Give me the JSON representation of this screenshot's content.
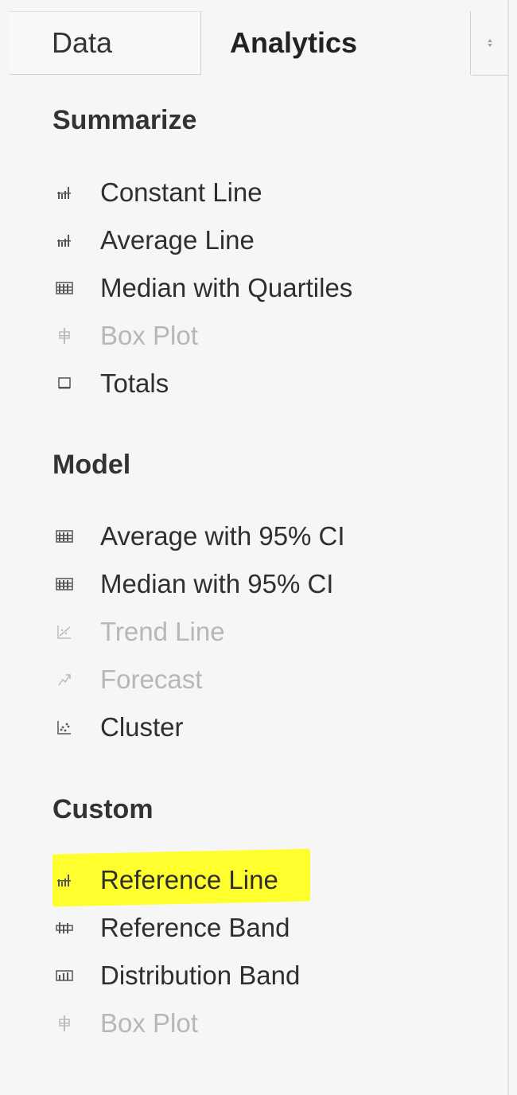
{
  "tabs": {
    "data_label": "Data",
    "analytics_label": "Analytics"
  },
  "sort_glyph": "sort-arrows",
  "highlight_color": "#ffff2e",
  "sections": {
    "summarize": {
      "title": "Summarize",
      "items": [
        {
          "label": "Constant Line",
          "icon": "constant-line-icon",
          "enabled": true
        },
        {
          "label": "Average Line",
          "icon": "average-line-icon",
          "enabled": true
        },
        {
          "label": "Median with Quartiles",
          "icon": "median-quartiles-icon",
          "enabled": true
        },
        {
          "label": "Box Plot",
          "icon": "box-plot-icon",
          "enabled": false
        },
        {
          "label": "Totals",
          "icon": "totals-icon",
          "enabled": true
        }
      ]
    },
    "model": {
      "title": "Model",
      "items": [
        {
          "label": "Average with 95% CI",
          "icon": "average-ci-icon",
          "enabled": true
        },
        {
          "label": "Median with 95% CI",
          "icon": "median-ci-icon",
          "enabled": true
        },
        {
          "label": "Trend Line",
          "icon": "trend-line-icon",
          "enabled": false
        },
        {
          "label": "Forecast",
          "icon": "forecast-icon",
          "enabled": false
        },
        {
          "label": "Cluster",
          "icon": "cluster-icon",
          "enabled": true
        }
      ]
    },
    "custom": {
      "title": "Custom",
      "items": [
        {
          "label": "Reference Line",
          "icon": "reference-line-icon",
          "enabled": true,
          "highlighted": true
        },
        {
          "label": "Reference Band",
          "icon": "reference-band-icon",
          "enabled": true
        },
        {
          "label": "Distribution Band",
          "icon": "distribution-band-icon",
          "enabled": true
        },
        {
          "label": "Box Plot",
          "icon": "box-plot-icon",
          "enabled": false
        }
      ]
    }
  }
}
